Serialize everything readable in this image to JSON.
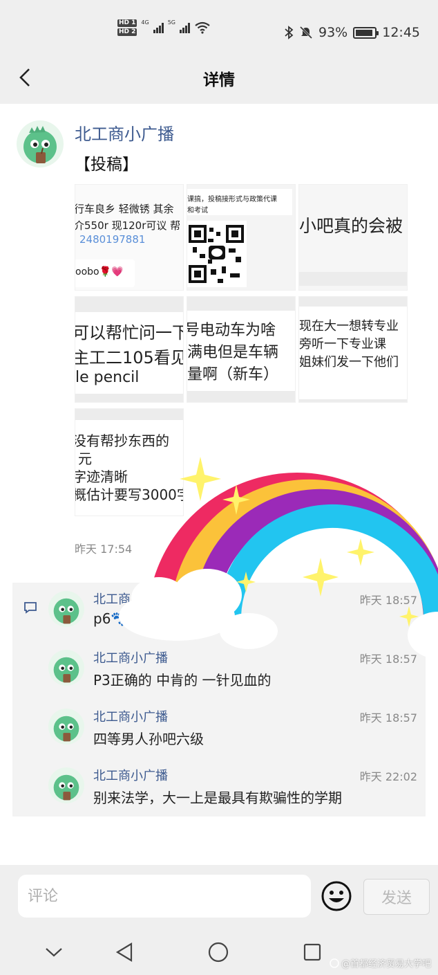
{
  "status_bar": {
    "hd1": "HD 1",
    "hd2": "HD 2",
    "net1": "4G",
    "net2": "5G",
    "battery": "93%",
    "time": "12:45"
  },
  "header": {
    "title": "详情"
  },
  "post": {
    "author": "北工商小广播",
    "text": "【投稿】",
    "images": {
      "c1": [
        "行车良乡 轻微锈 其余",
        "介550r 现120r可议 帮",
        "2480197881"
      ],
      "c1b": "oobo🌹💗",
      "c2": [
        "课搞，投稿接形式与政策代课",
        "和考试"
      ],
      "c3": "小吧真的会被",
      "c4": [
        "可以帮忙问一下",
        "主工二105看见",
        "le pencil"
      ],
      "c5": [
        "号电动车为啥",
        "满电但是车辆",
        "量啊（新车）"
      ],
      "c6": [
        "现在大一想转专业",
        "旁听一下专业课 ",
        "姐妹们发一下他们"
      ],
      "c7": [
        "没有帮抄东西的",
        "元",
        "字迹清晰",
        "概估计要写3000字"
      ]
    },
    "time": "昨天 17:54"
  },
  "comments": [
    {
      "name": "北工商小广播",
      "time": "昨天 18:57",
      "text": "p6🐾"
    },
    {
      "name": "北工商小广播",
      "time": "昨天 18:57",
      "text": "P3正确的 中肯的 一针见血的"
    },
    {
      "name": "北工商小广播",
      "time": "昨天 18:57",
      "text": "四等男人孙吧六级"
    },
    {
      "name": "北工商小广播",
      "time": "昨天 22:02",
      "text": "别来法学，大一上是最具有欺骗性的学期"
    }
  ],
  "input_bar": {
    "placeholder": "评论",
    "send_label": "发送"
  },
  "watermark": "@首都经济贸易大学吧",
  "colors": {
    "link": "#3d5a8f",
    "bg_gray": "#efefef",
    "comment_bg": "#f3f3f3"
  }
}
